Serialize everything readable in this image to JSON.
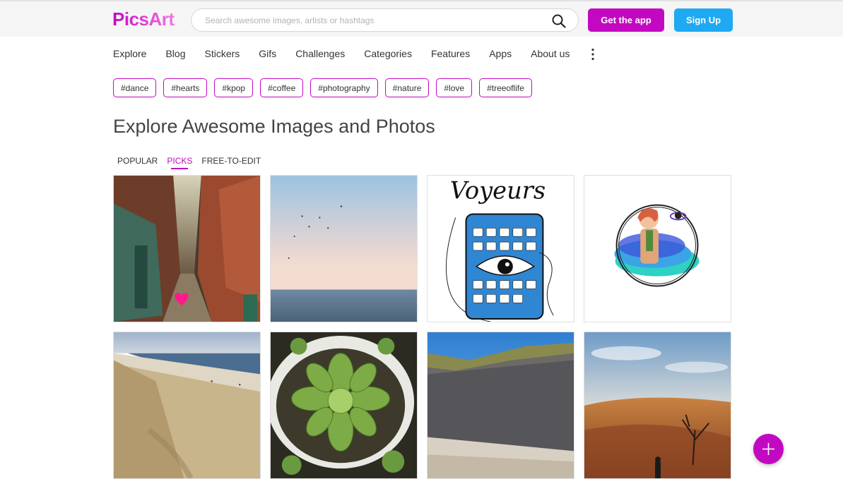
{
  "header": {
    "logo_text": "PicsArt",
    "search_placeholder": "Search awesome images, artists or hashtags",
    "get_app_label": "Get the app",
    "signup_label": "Sign Up"
  },
  "nav": {
    "items": [
      "Explore",
      "Blog",
      "Stickers",
      "Gifs",
      "Challenges",
      "Categories",
      "Features",
      "Apps",
      "About us"
    ],
    "more_icon": "kebab-vertical-icon"
  },
  "hashtags": [
    "#dance",
    "#hearts",
    "#kpop",
    "#coffee",
    "#photography",
    "#nature",
    "#love",
    "#treeoflife"
  ],
  "page": {
    "title": "Explore Awesome Images and Photos"
  },
  "tabs": {
    "items": [
      "POPULAR",
      "PICKS",
      "FREE-TO-EDIT"
    ],
    "active": "PICKS"
  },
  "grid": {
    "images": [
      {
        "subject": "narrow alley with heart"
      },
      {
        "subject": "sea at dusk with birds"
      },
      {
        "subject": "Voyeurs phone sketch",
        "caption": "Voyeurs"
      },
      {
        "subject": "anime character in circle"
      },
      {
        "subject": "sandy beach"
      },
      {
        "subject": "succulent plant"
      },
      {
        "subject": "sand dune cliff"
      },
      {
        "subject": "desert with dead tree"
      }
    ]
  },
  "colors": {
    "brand": "#c209c1",
    "signup": "#1fa9f2",
    "header_bg": "#f5f5f5"
  }
}
